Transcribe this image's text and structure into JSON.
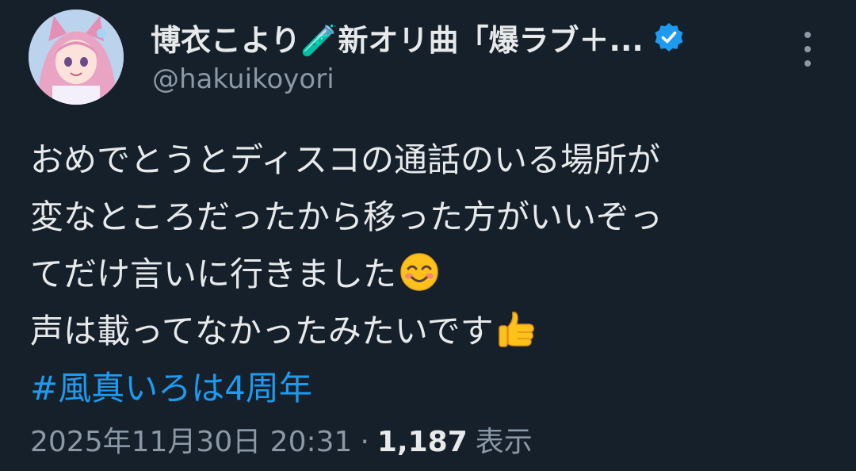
{
  "author": {
    "display_name": "博衣こより🧪新オリ曲「爆ラブ＋...",
    "handle": "@hakuikoyori",
    "verified": true,
    "accent_color": "#1d9bf0"
  },
  "icons": {
    "verified": "verified-badge-icon",
    "more": "more-options-icon",
    "smile": "smiling-face-emoji",
    "thumbs_up": "thumbs-up-emoji"
  },
  "tweet": {
    "lines": [
      "おめでとうとディスコの通話のいる場所が",
      "変なところだったから移った方がいいぞっ",
      "てだけ言いに行きました",
      "声は載ってなかったみたいです"
    ],
    "hashtag": "#風真いろは4周年"
  },
  "meta": {
    "timestamp": "2025年11月30日 20:31",
    "separator": "·",
    "views_count": "1,187",
    "views_label": "表示"
  },
  "colors": {
    "background": "#15202b",
    "text_primary": "#e7e9ea",
    "text_secondary": "#8b98a5",
    "link": "#1d9bf0"
  }
}
